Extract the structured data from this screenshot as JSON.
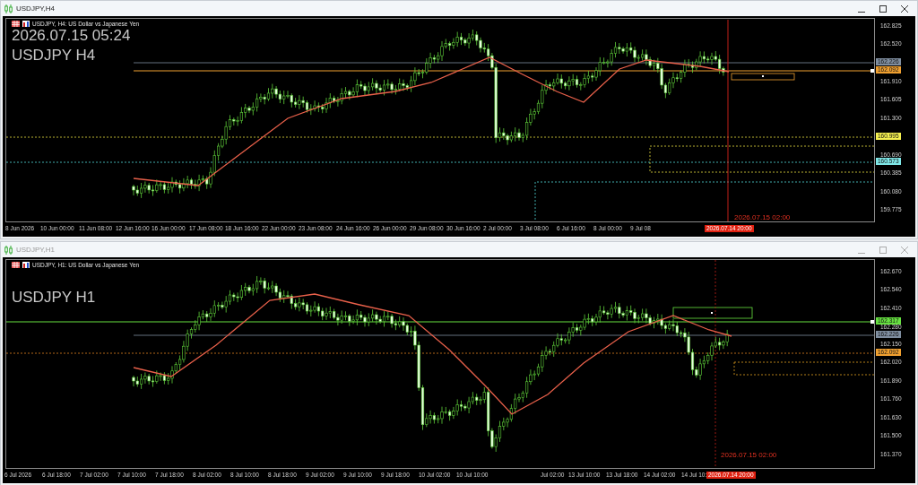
{
  "windows": [
    {
      "title": "USDJPY,H4",
      "active": true,
      "caption": "USDJPY, H4:  US Dollar vs Japanese Yen",
      "overlay_texts": [
        "2026.07.15 05:24",
        "USDJPY H4"
      ],
      "price_labels": [
        {
          "text": "162.825",
          "kind": "tick"
        },
        {
          "text": "162.520",
          "kind": "tick"
        },
        {
          "text": "162.226",
          "kind": "tag",
          "color": "#7f8ea0"
        },
        {
          "text": "162.092",
          "kind": "tag",
          "color": "#f0a030"
        },
        {
          "text": "161.910",
          "kind": "tick"
        },
        {
          "text": "161.605",
          "kind": "tick"
        },
        {
          "text": "161.300",
          "kind": "tick"
        },
        {
          "text": "160.995",
          "kind": "tag",
          "color": "#f5f050"
        },
        {
          "text": "160.690",
          "kind": "tick"
        },
        {
          "text": "160.573",
          "kind": "tag",
          "color": "#7fe8e8"
        },
        {
          "text": "160.385",
          "kind": "tick"
        },
        {
          "text": "160.080",
          "kind": "tick"
        },
        {
          "text": "159.775",
          "kind": "tick"
        }
      ],
      "time_labels": [
        "8 Jun 2026",
        "10 Jun 00:00",
        "11 Jun 08:00",
        "12 Jun 16:00",
        "16 Jun 00:00",
        "17 Jun 08:00",
        "18 Jun 16:00",
        "22 Jun 00:00",
        "23 Jun 08:00",
        "24 Jun 16:00",
        "26 Jun 00:00",
        "29 Jun 08:00",
        "30 Jun 16:00",
        "2 Jul 00:00",
        "3 Jul 08:00",
        "6 Jul 16:00",
        "8 Jul 00:00",
        "9 Jul 08"
      ],
      "cursor_time": "2026.07.14 20:00",
      "marker_time": "2026.07.15 02:00"
    },
    {
      "title": "USDJPY,H1",
      "active": false,
      "caption": "USDJPY, H1:  US Dollar vs Japanese Yen",
      "overlay_texts": [
        "USDJPY H1"
      ],
      "price_labels": [
        {
          "text": "162.670",
          "kind": "tick"
        },
        {
          "text": "162.540",
          "kind": "tick"
        },
        {
          "text": "162.410",
          "kind": "tick"
        },
        {
          "text": "162.317",
          "kind": "tag",
          "color": "#66e040"
        },
        {
          "text": "162.280",
          "kind": "tick"
        },
        {
          "text": "162.226",
          "kind": "tag",
          "color": "#7f8ea0"
        },
        {
          "text": "162.150",
          "kind": "tick"
        },
        {
          "text": "162.092",
          "kind": "tag",
          "color": "#f0a030"
        },
        {
          "text": "162.020",
          "kind": "tick"
        },
        {
          "text": "161.890",
          "kind": "tick"
        },
        {
          "text": "161.760",
          "kind": "tick"
        },
        {
          "text": "161.630",
          "kind": "tick"
        },
        {
          "text": "161.500",
          "kind": "tick"
        },
        {
          "text": "161.370",
          "kind": "tick"
        }
      ],
      "time_labels": [
        "6 Jul 2026",
        "6 Jul 18:00",
        "7 Jul 02:00",
        "7 Jul 10:00",
        "7 Jul 18:00",
        "8 Jul 02:00",
        "8 Jul 10:00",
        "8 Jul 18:00",
        "9 Jul 02:00",
        "9 Jul 10:00",
        "9 Jul 18:00",
        "10 Jul 02:00",
        "10 Jul 10:00",
        "Jul 02:00",
        "13 Jul 10:00",
        "13 Jul 18:00",
        "14 Jul 02:00",
        "14 Jul 10:"
      ],
      "cursor_time": "2026.07.14 20:00",
      "marker_time": "2026.07.15 02:00"
    }
  ]
}
